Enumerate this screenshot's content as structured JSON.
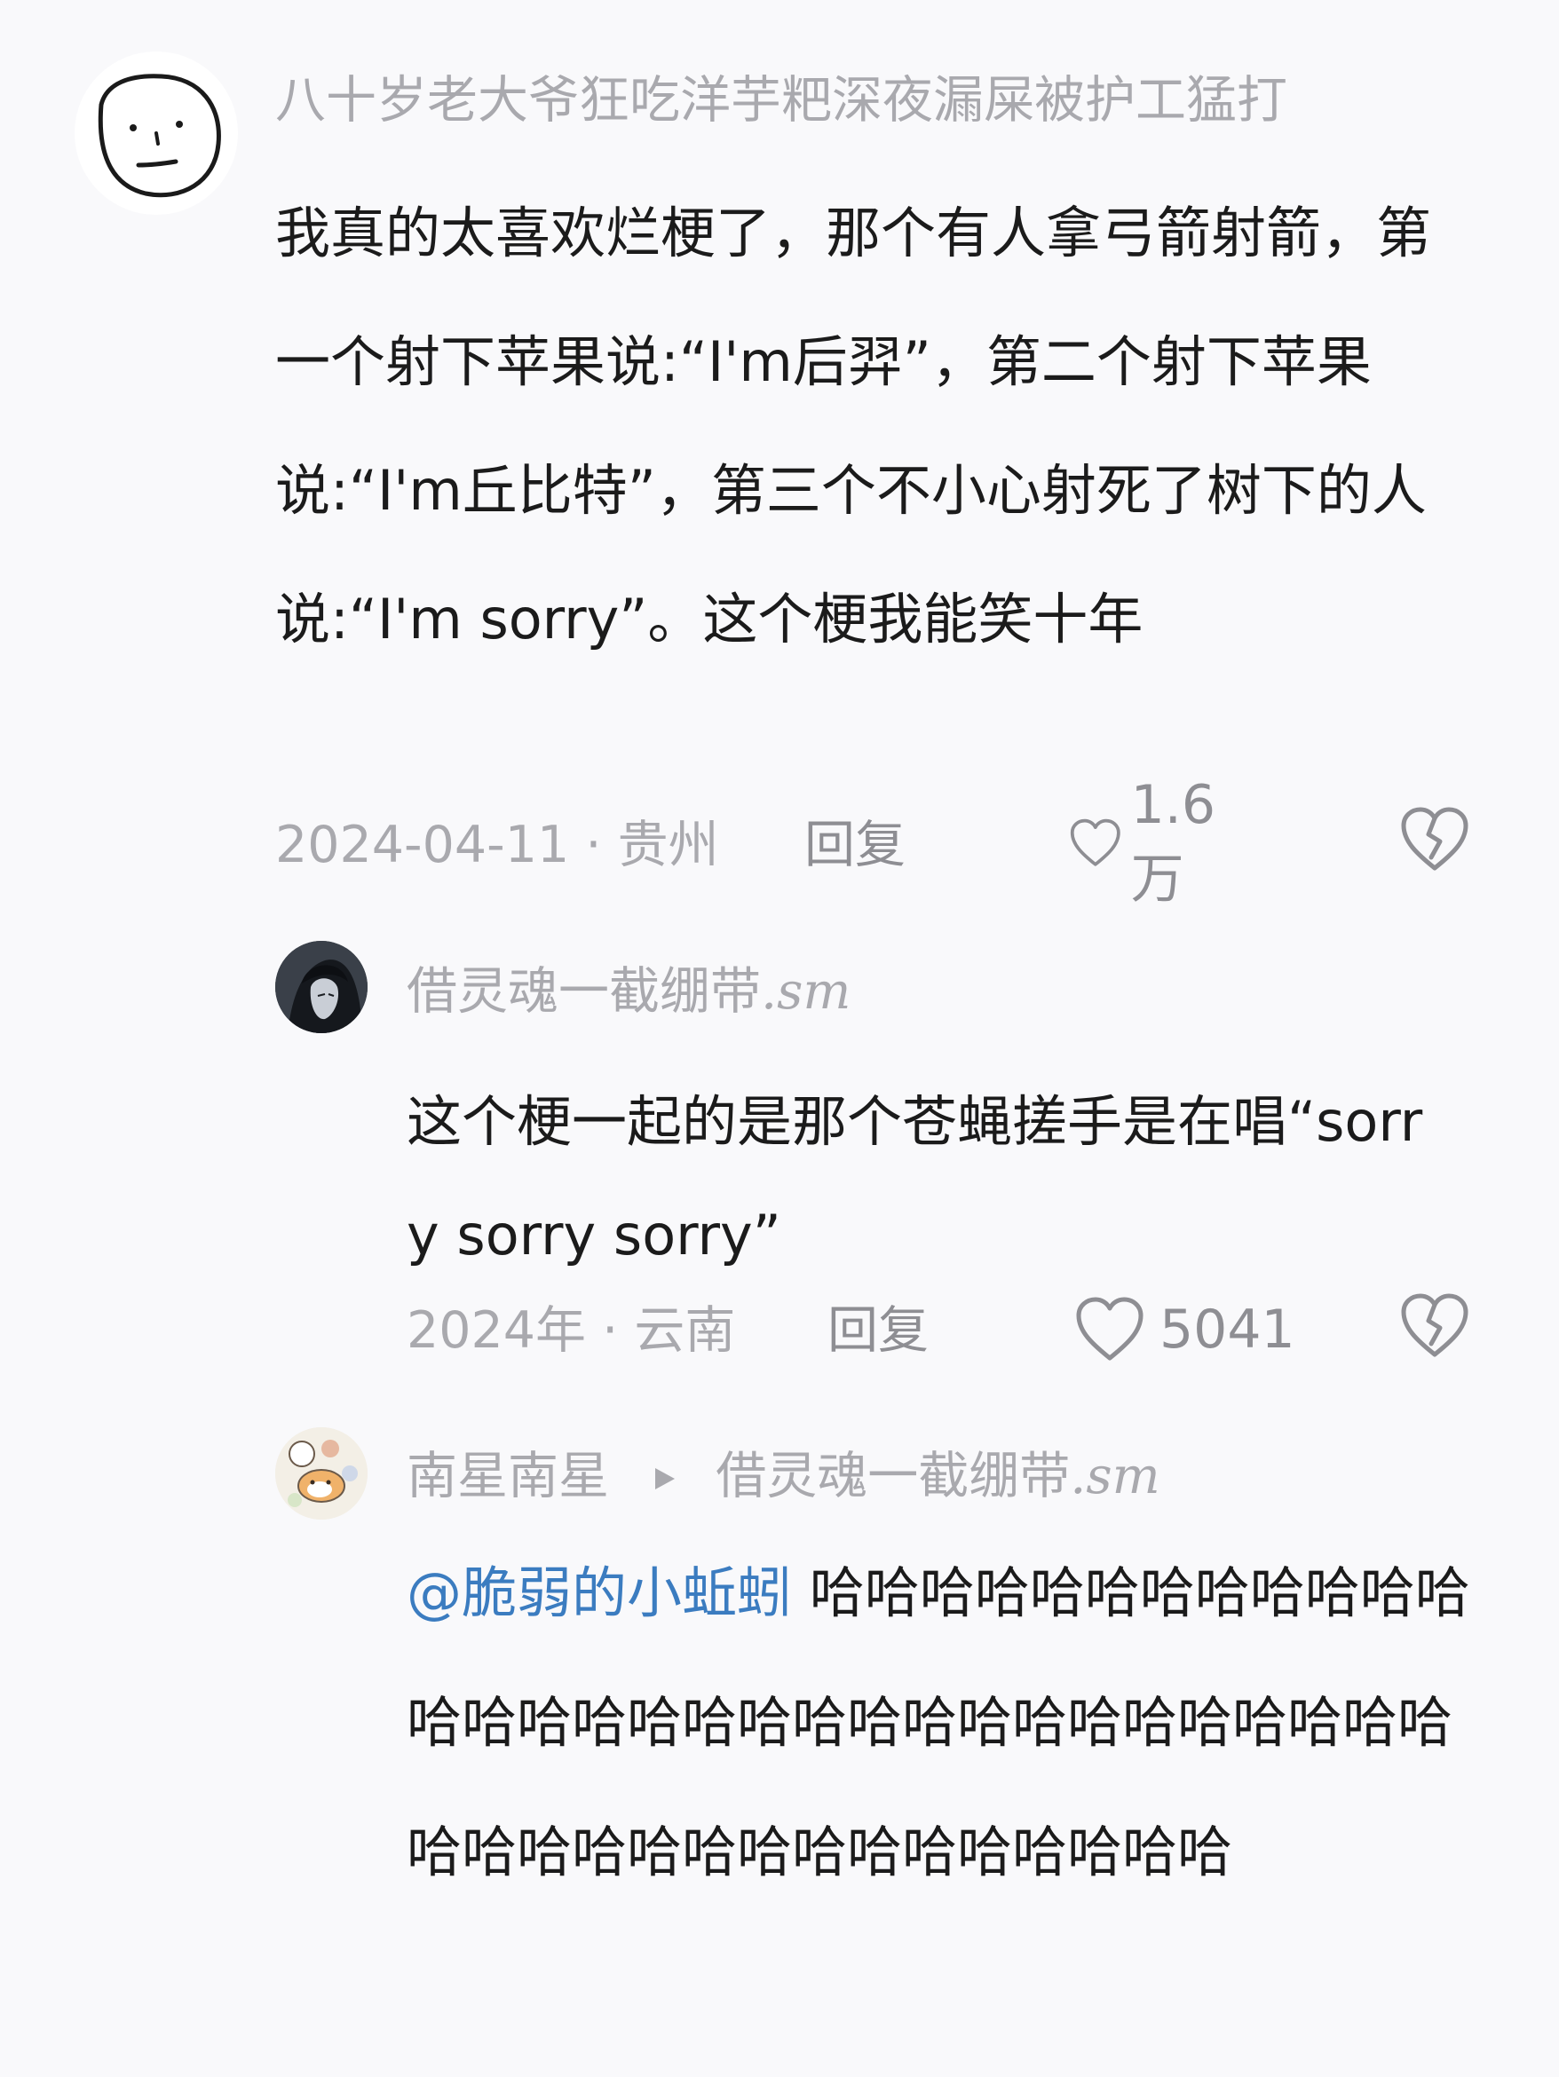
{
  "comments": [
    {
      "username": "八十岁老大爷狂吃洋芋粑深夜漏屎被护工猛打",
      "text": "我真的太喜欢烂梗了，那个有人拿弓箭射箭，第一个射下苹果说:“I'm后羿”，第二个射下苹果说:“I'm丘比特”，第三个不小心射死了树下的人说:“I'm sorry”。这个梗我能笑十年",
      "date": "2024-04-11",
      "location": "贵州",
      "reply_label": "回复",
      "likes": "1.6万"
    },
    {
      "username": "借灵魂一截绷带",
      "username_suffix": ".sm",
      "text": "这个梗一起的是那个苍蝇搓手是在唱“sorry sorry sorry”",
      "date": "2024年",
      "location": "云南",
      "reply_label": "回复",
      "likes": "5041"
    },
    {
      "username": "南星南星",
      "reply_to": "借灵魂一截绷带",
      "reply_to_suffix": ".sm",
      "mention": "@脆弱的小蚯蚓",
      "text": " 哈哈哈哈哈哈哈哈哈哈哈哈哈哈哈哈哈哈哈哈哈哈哈哈哈哈哈哈哈哈哈哈哈哈哈哈哈哈哈哈哈哈哈哈哈哈"
    }
  ],
  "meta_separator": " · ",
  "colors": {
    "background": "#f9f9fb",
    "muted_text": "#a9a9ae",
    "body_text": "#1b1b1b",
    "mention": "#3b7cc0"
  },
  "icons": {
    "like": "heart-outline-icon",
    "dislike": "broken-heart-icon",
    "reply_arrow": "triangle-right-icon"
  }
}
